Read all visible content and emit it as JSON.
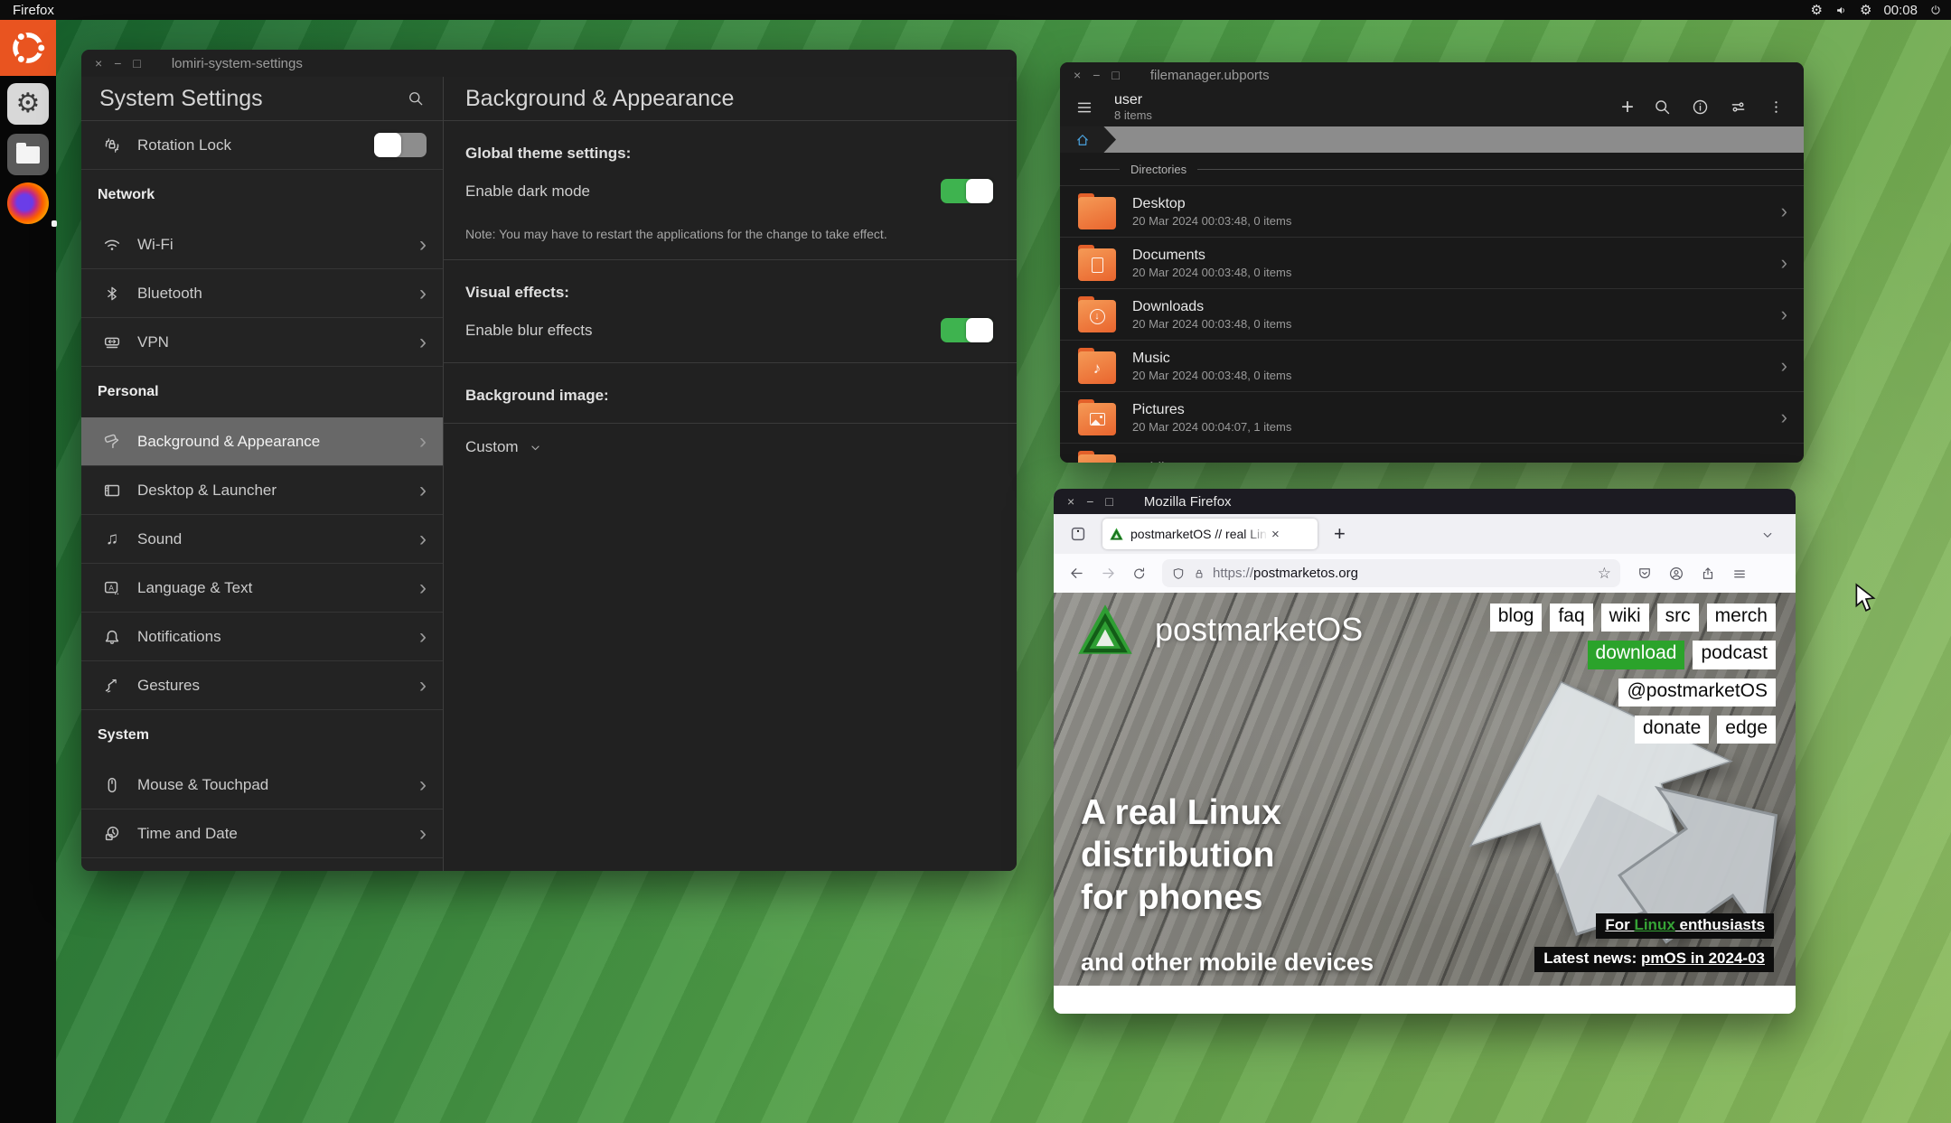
{
  "topbar": {
    "app_name": "Firefox",
    "clock": "00:08"
  },
  "window_controls": {
    "close": "×",
    "minimize": "−",
    "maximize": "□"
  },
  "settings_window": {
    "title": "lomiri-system-settings",
    "sidebar": {
      "title": "System Settings",
      "rotation_lock_label": "Rotation Lock",
      "sections": [
        {
          "heading": "Network",
          "items": [
            "Wi-Fi",
            "Bluetooth",
            "VPN"
          ]
        },
        {
          "heading": "Personal",
          "items": [
            "Background & Appearance",
            "Desktop & Launcher",
            "Sound",
            "Language & Text",
            "Notifications",
            "Gestures"
          ]
        },
        {
          "heading": "System",
          "items": [
            "Mouse & Touchpad",
            "Time and Date"
          ]
        }
      ],
      "selected_item": "Background & Appearance"
    },
    "panel": {
      "title": "Background & Appearance",
      "theme_heading": "Global theme settings:",
      "dark_mode_label": "Enable dark mode",
      "note": "Note: You may have to restart the applications for the change to take effect.",
      "effects_heading": "Visual effects:",
      "blur_label": "Enable blur effects",
      "background_heading": "Background image:",
      "background_value": "Custom"
    }
  },
  "filemanager_window": {
    "title": "filemanager.ubports",
    "location": "user",
    "items_count": "8 items",
    "section_label": "Directories",
    "rows": [
      {
        "name": "Desktop",
        "meta": "20 Mar 2024 00:03:48, 0 items"
      },
      {
        "name": "Documents",
        "meta": "20 Mar 2024 00:03:48, 0 items"
      },
      {
        "name": "Downloads",
        "meta": "20 Mar 2024 00:03:48, 0 items"
      },
      {
        "name": "Music",
        "meta": "20 Mar 2024 00:03:48, 0 items"
      },
      {
        "name": "Pictures",
        "meta": "20 Mar 2024 00:04:07, 1 items"
      },
      {
        "name": "Public",
        "meta": ""
      }
    ],
    "music_glyph": "♪"
  },
  "firefox_window": {
    "title": "Mozilla Firefox",
    "tab_label": "postmarketOS // real Lin",
    "tab_close": "×",
    "new_tab": "+",
    "url_scheme": "https://",
    "url_host": "postmarketos.org",
    "star": "☆",
    "page": {
      "brand": "postmarketOS",
      "nav_row1": [
        "blog",
        "faq",
        "wiki",
        "src",
        "merch"
      ],
      "nav_row2": [
        "download",
        "podcast"
      ],
      "nav_row3": [
        "@postmarketOS"
      ],
      "nav_row4": [
        "donate",
        "edge"
      ],
      "active_nav": "download",
      "hero_line1": "A real Linux",
      "hero_line2": "distribution",
      "hero_line3": "for phones",
      "hero_sub": "and other mobile devices",
      "enthusiasts_pre": "For ",
      "enthusiasts_highlight": "Linux",
      "enthusiasts_post": " enthusiasts",
      "news_label": "Latest news: ",
      "news_link": "pmOS in 2024-03",
      "accent_green": "#2ba32b"
    }
  },
  "colors": {
    "toggle_on": "#3eb34f",
    "folder_orange": "#e9652e",
    "wallpaper_green": "#4f9d47"
  }
}
